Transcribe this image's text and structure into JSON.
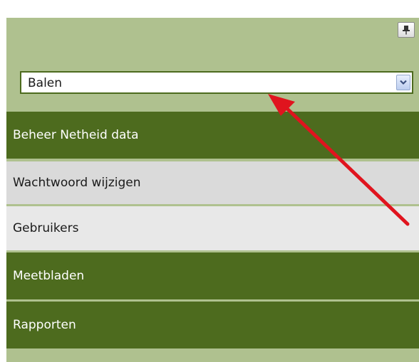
{
  "location_select": {
    "selected": "Balen",
    "icon": "chevron-down-icon"
  },
  "pin_icon": "pin-icon",
  "menu": {
    "items": [
      {
        "label": "Beheer Netheid data"
      },
      {
        "label": "Wachtwoord wijzigen"
      },
      {
        "label": "Gebruikers"
      },
      {
        "label": "Meetbladen"
      },
      {
        "label": "Rapporten"
      }
    ]
  },
  "colors": {
    "panel_bg": "#afc18f",
    "menu_green": "#4d6b1e",
    "menu_gray_light": "#e8e8e8",
    "menu_gray": "#dadada",
    "annotation_arrow": "#e0141e"
  }
}
